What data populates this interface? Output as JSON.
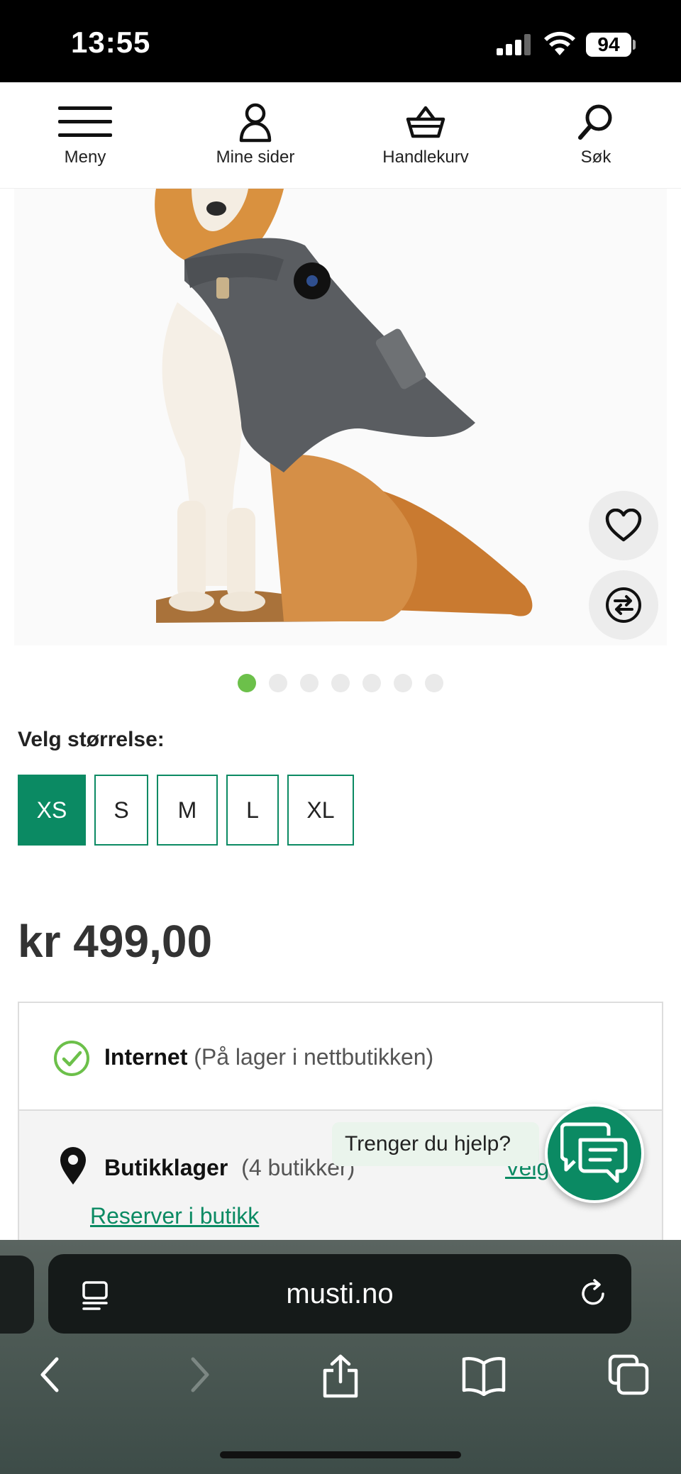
{
  "status_bar": {
    "time": "13:55",
    "battery": "94"
  },
  "nav": {
    "menu_label": "Meny",
    "account_label": "Mine sider",
    "cart_label": "Handlekurv",
    "search_label": "Søk"
  },
  "carousel": {
    "total_images": 7,
    "active_index": 0
  },
  "size_selector": {
    "label": "Velg størrelse:",
    "options": [
      "XS",
      "S",
      "M",
      "L",
      "XL"
    ],
    "selected": "XS"
  },
  "price": "kr 499,00",
  "stock": {
    "internet_label": "Internet",
    "internet_status": "(På lager i nettbutikken)",
    "store_label": "Butikklager",
    "store_count": "(4 butikker)",
    "velg_link": "Velg",
    "reserve_link": "Reserver i butikk"
  },
  "help": {
    "bubble_text": "Trenger du hjelp?"
  },
  "browser": {
    "url": "musti.no"
  },
  "colors": {
    "accent": "#0b8a63",
    "dot_active": "#6cc04a"
  }
}
